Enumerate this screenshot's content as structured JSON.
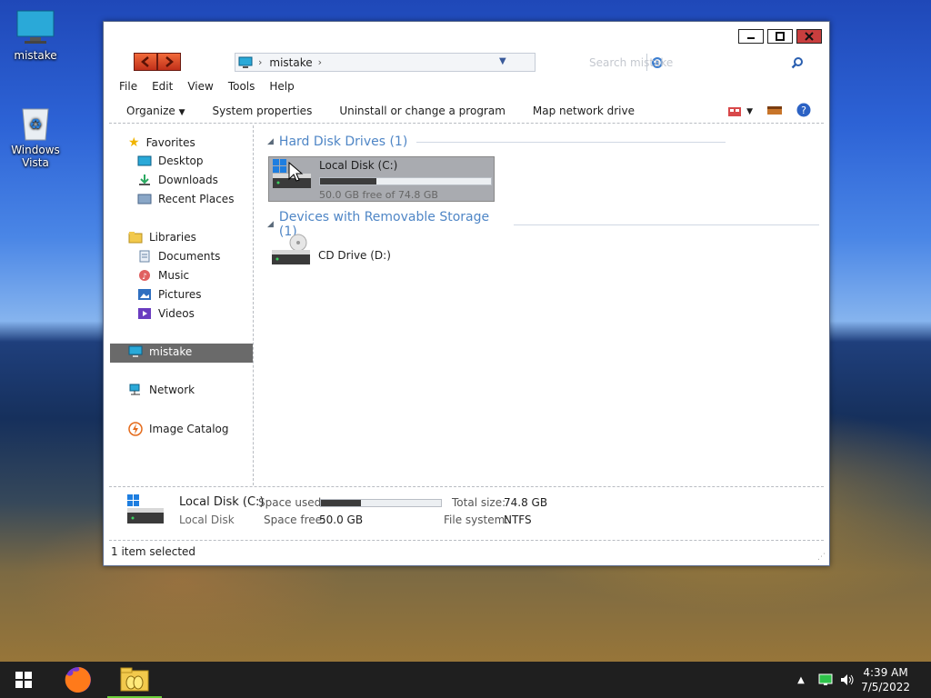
{
  "desktop": {
    "icons": [
      {
        "label": "mistake",
        "icon": "computer-icon"
      },
      {
        "label": "Windows Vista",
        "icon": "recycle-bin-icon"
      }
    ]
  },
  "window": {
    "address": {
      "location": "mistake"
    },
    "search": {
      "placeholder": "Search mistake"
    },
    "menu": [
      "File",
      "Edit",
      "View",
      "Tools",
      "Help"
    ],
    "commands": [
      "Organize",
      "System properties",
      "Uninstall or change a program",
      "Map network drive"
    ],
    "nav_pane": {
      "favorites": {
        "header": "Favorites",
        "items": [
          "Desktop",
          "Downloads",
          "Recent Places"
        ]
      },
      "libraries": {
        "header": "Libraries",
        "items": [
          "Documents",
          "Music",
          "Pictures",
          "Videos"
        ]
      },
      "computer": "mistake",
      "network": "Network",
      "image_catalog": "Image Catalog"
    },
    "groups": {
      "hard_disks": {
        "title": "Hard Disk Drives (1)",
        "drives": [
          {
            "name": "Local Disk (C:)",
            "free_text": "50.0 GB free of 74.8 GB",
            "used_fraction": 0.33
          }
        ]
      },
      "removable": {
        "title": "Devices with Removable Storage (1)",
        "drives": [
          {
            "name": "CD Drive (D:)"
          }
        ]
      }
    },
    "details": {
      "name": "Local Disk (C:)",
      "type": "Local Disk",
      "space_used_label": "Space used:",
      "space_used_fraction": 0.33,
      "space_free_label": "Space free:",
      "space_free": "50.0 GB",
      "total_size_label": "Total size:",
      "total_size": "74.8 GB",
      "file_system_label": "File system:",
      "file_system": "NTFS"
    },
    "status": "1 item selected"
  },
  "taskbar": {
    "clock_time": "4:39 AM",
    "clock_date": "7/5/2022"
  },
  "colors": {
    "accent": "#4f86c6",
    "selection": "#6a6a6a",
    "taskbar": "#1f1f1f"
  }
}
